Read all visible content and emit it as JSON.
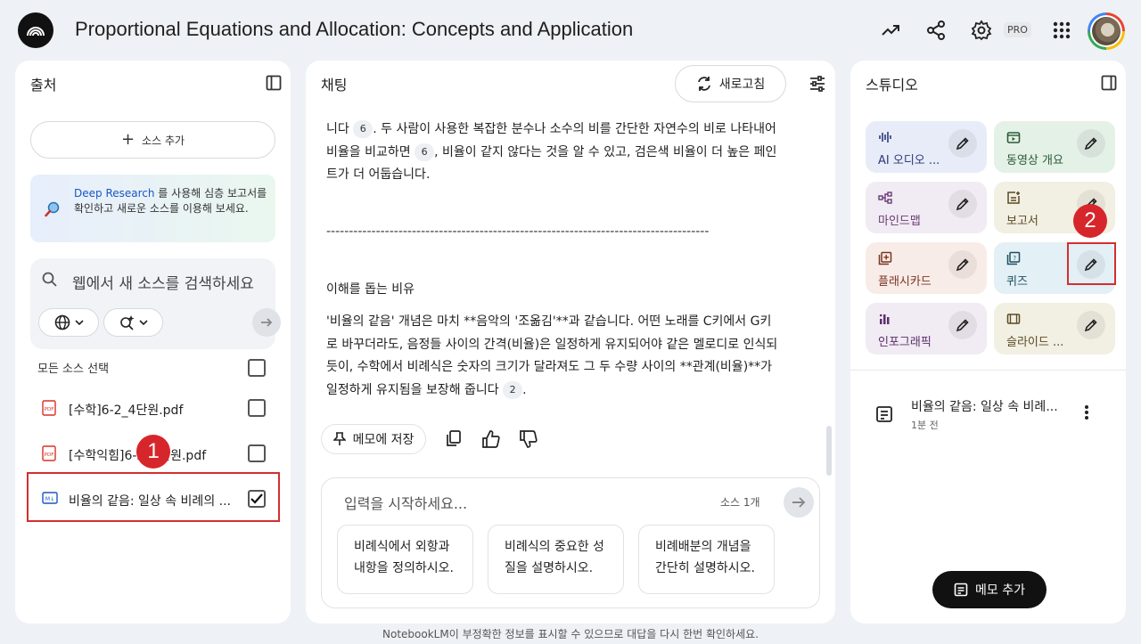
{
  "header": {
    "title": "Proportional Equations and Allocation: Concepts and Application",
    "pro_badge": "PRO",
    "icons": [
      "analytics-icon",
      "share-icon",
      "settings-icon",
      "apps-grid-icon"
    ]
  },
  "sources_panel": {
    "title": "출처",
    "add_source": "소스 추가",
    "deep_research_link": "Deep Research",
    "deep_research_text": " 를 사용해 심층 보고서를 확인하고 새로운 소스를 이용해 보세요.",
    "search_placeholder": "웹에서 새 소스를 검색하세요",
    "select_all": "모든 소스 선택",
    "sources": [
      {
        "label": "[수학]6-2_4단원.pdf",
        "type": "pdf",
        "checked": false
      },
      {
        "label": "[수학익힘]6-2_4단원.pdf",
        "type": "pdf",
        "checked": false
      },
      {
        "label": "비율의 같음: 일상 속 비례의 ...",
        "type": "markdown",
        "checked": true
      }
    ]
  },
  "chat_panel": {
    "title": "채팅",
    "refresh": "새로고침",
    "para1_a": "니다",
    "cite_6": "6",
    "para1_b": ". 두 사람이 사용한 복잡한 분수나 소수의 비를 간단한 자연수의 비로 나타내어 비율을 비교하면",
    "para1_c": ", 비율이 같지 않다는 것을 알 수 있고, 검은색 비율이 더 높은 페인트가 더 어둡습니다.",
    "dashes": "-------------------------------------------------------------------------------------",
    "section_heading": "이해를 돕는 비유",
    "para2": "'비율의 같음' 개념은 마치 **음악의 '조옮김'**과 같습니다. 어떤 노래를 C키에서 G키로 바꾸더라도, 음정들 사이의 간격(비율)은 일정하게 유지되어야 같은 멜로디로 인식되듯이, 수학에서 비례식은 숫자의 크기가 달라져도 그 두 수량 사이의 **관계(비율)**가 일정하게 유지됨을 보장해 줍니다",
    "cite_2": "2",
    "para2_end": ".",
    "save_memo": "메모에 저장",
    "input_placeholder": "입력을 시작하세요...",
    "source_count": "소스 1개",
    "suggestions": [
      "비례식에서 외항과 내항을 정의하시오.",
      "비례식의 중요한 성질을 설명하시오.",
      "비례배분의 개념을 간단히 설명하시오."
    ]
  },
  "studio_panel": {
    "title": "스튜디오",
    "tiles": [
      {
        "label": "AI 오디오 ...",
        "icon": "audio-waveform-icon",
        "color": "#e7ecf8",
        "text": "#2a3a7a"
      },
      {
        "label": "동영상 개요",
        "icon": "video-icon",
        "color": "#e4f1e7",
        "text": "#2b5a36"
      },
      {
        "label": "마인드맵",
        "icon": "mindmap-icon",
        "color": "#f1ebf3",
        "text": "#6b3a76"
      },
      {
        "label": "보고서",
        "icon": "report-icon",
        "color": "#f2efe3",
        "text": "#5a4a22"
      },
      {
        "label": "플래시카드",
        "icon": "flashcard-icon",
        "color": "#f8ece8",
        "text": "#7a3520"
      },
      {
        "label": "퀴즈",
        "icon": "quiz-icon",
        "color": "#e3f0f5",
        "text": "#1f4f62"
      },
      {
        "label": "인포그래픽",
        "icon": "infographic-icon",
        "color": "#f1ebf3",
        "text": "#5a2f6a"
      },
      {
        "label": "슬라이드 ...",
        "icon": "slides-icon",
        "color": "#f2efe3",
        "text": "#5a4a22"
      }
    ],
    "note_title": "비율의 같음: 일상 속 비례...",
    "note_time": "1분 전",
    "add_memo": "메모 추가"
  },
  "annotations": {
    "badge1": "1",
    "badge2": "2",
    "highlight_color": "#d32f2f"
  },
  "footer": "NotebookLM이 부정확한 정보를 표시할 수 있으므로 대답을 다시 한번 확인하세요."
}
